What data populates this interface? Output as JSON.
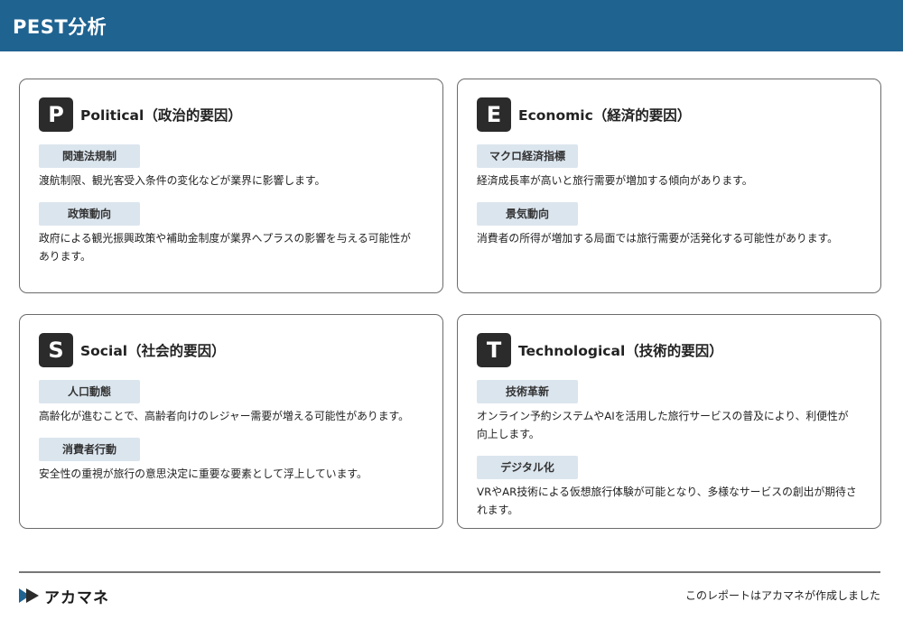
{
  "header": {
    "title": "PEST分析"
  },
  "cards": [
    {
      "letter": "P",
      "title": "Political（政治的要因）",
      "items": [
        {
          "tag": "関連法規制",
          "text": "渡航制限、観光客受入条件の変化などが業界に影響します。"
        },
        {
          "tag": "政策動向",
          "text": "政府による観光振興政策や補助金制度が業界へプラスの影響を与える可能性があります。"
        }
      ]
    },
    {
      "letter": "E",
      "title": "Economic（経済的要因）",
      "items": [
        {
          "tag": "マクロ経済指標",
          "text": "経済成長率が高いと旅行需要が増加する傾向があります。"
        },
        {
          "tag": "景気動向",
          "text": "消費者の所得が増加する局面では旅行需要が活発化する可能性があります。"
        }
      ]
    },
    {
      "letter": "S",
      "title": "Social（社会的要因）",
      "items": [
        {
          "tag": "人口動態",
          "text": "高齢化が進むことで、高齢者向けのレジャー需要が増える可能性があります。"
        },
        {
          "tag": "消費者行動",
          "text": "安全性の重視が旅行の意思決定に重要な要素として浮上しています。"
        }
      ]
    },
    {
      "letter": "T",
      "title": "Technological（技術的要因）",
      "items": [
        {
          "tag": "技術革新",
          "text": "オンライン予約システムやAIを活用した旅行サービスの普及により、利便性が向上します。"
        },
        {
          "tag": "デジタル化",
          "text": "VRやAR技術による仮想旅行体験が可能となり、多様なサービスの創出が期待されます。"
        }
      ]
    }
  ],
  "footer": {
    "brand": "アカマネ",
    "credit": "このレポートはアカマネが作成しました"
  },
  "colors": {
    "header_bg": "#1f6391",
    "tag_bg": "#dbe5ee",
    "letter_bg": "#2b2b2b"
  },
  "icons": {
    "brand": "play-arrow-logo-icon"
  }
}
